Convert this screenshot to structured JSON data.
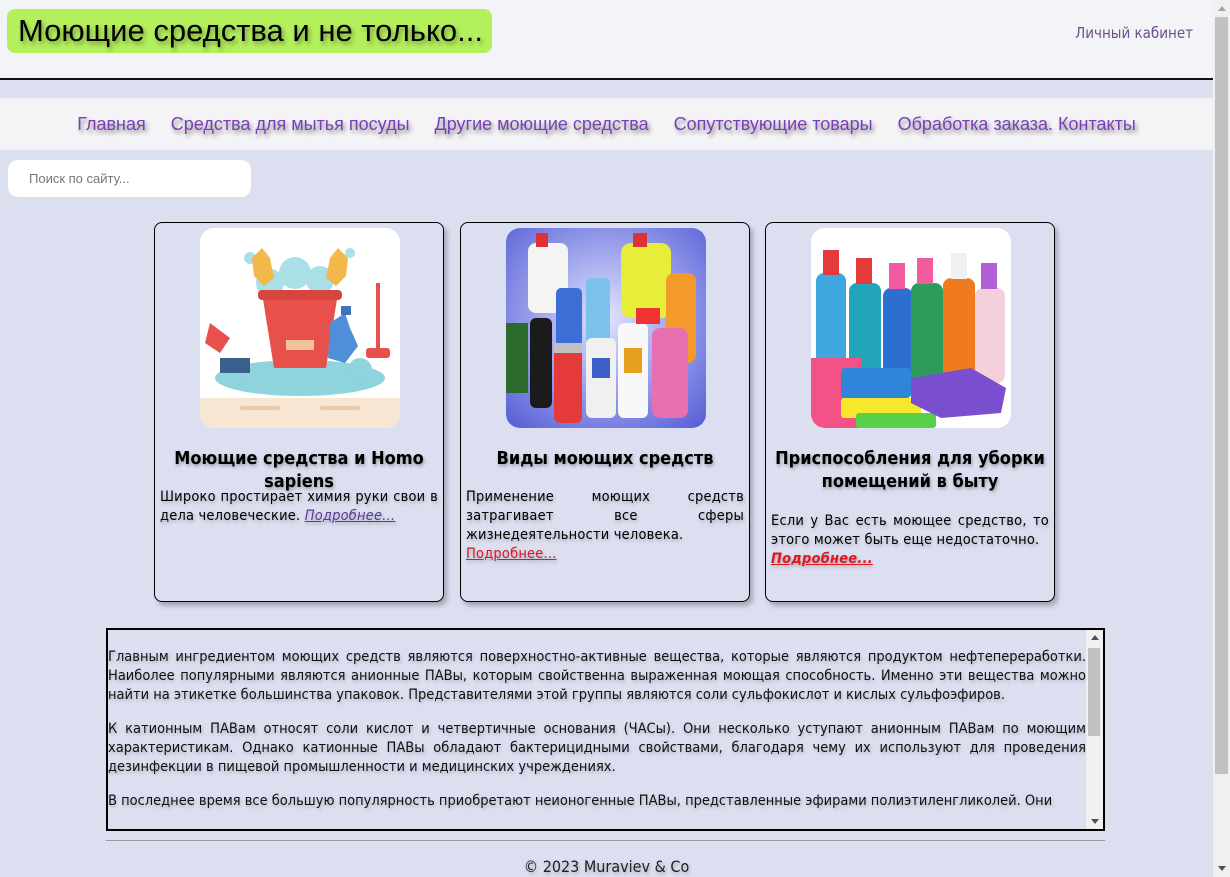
{
  "site": {
    "logo": "Моющие средства и не только...",
    "account_link": "Личный кабинет"
  },
  "nav": [
    {
      "label": "Главная"
    },
    {
      "label": "Средства для мытья посуды"
    },
    {
      "label": "Другие моющие средства"
    },
    {
      "label": "Сопутствующие товары"
    },
    {
      "label": "Обработка заказа. Контакты"
    }
  ],
  "search": {
    "placeholder": "Поиск по сайту..."
  },
  "cards": [
    {
      "title": "Моющие средства и Homo sapiens",
      "text": "Широко простирает химия руки свои в дела человеческие.",
      "more": "Подробнее..."
    },
    {
      "title": "Виды моющих средств",
      "text": "Применение моющих средств затрагивает все сферы жизнедеятельности человека.",
      "more": "Подробнее..."
    },
    {
      "title": "Приспособления для уборки помещений в быту",
      "text": "Если у Вас есть моющее средство, то этого может быть еще недостаточно.",
      "more": "Подробнее..."
    }
  ],
  "article": {
    "paragraphs": [
      "Главным ингредиентом моющих средств являются поверхностно-активные вещества, которые являются продуктом нефтепереработки. Наиболее популярными являются анионные ПАВы, которым свойственна выраженная моющая способность. Именно эти вещества можно найти на этикетке большинства упаковок. Представителями этой группы являются соли сульфокислот и кислых сульфоэфиров.",
      "К катионным ПАВам относят соли кислот и четвертичные основания (ЧАСы). Они несколько уступают анионным ПАВам по моющим характеристикам. Однако катионные ПАВы обладают бактерицидными свойствами, благодаря чему их используют для проведения дезинфекции в пищевой промышленности и медицинских учреждениях.",
      "В последнее время все большую популярность приобретают неионогенные ПАВы, представленные эфирами полиэтиленгликолей. Они"
    ]
  },
  "footer": {
    "copyright": "© 2023 Muraviev & Co"
  },
  "colors": {
    "background": "#dcdff0",
    "logo_bg": "#b4ef5c",
    "nav_link": "#7a3fb8",
    "more_link_red": "#e0161e",
    "more_link_purple": "#5a3a96"
  }
}
